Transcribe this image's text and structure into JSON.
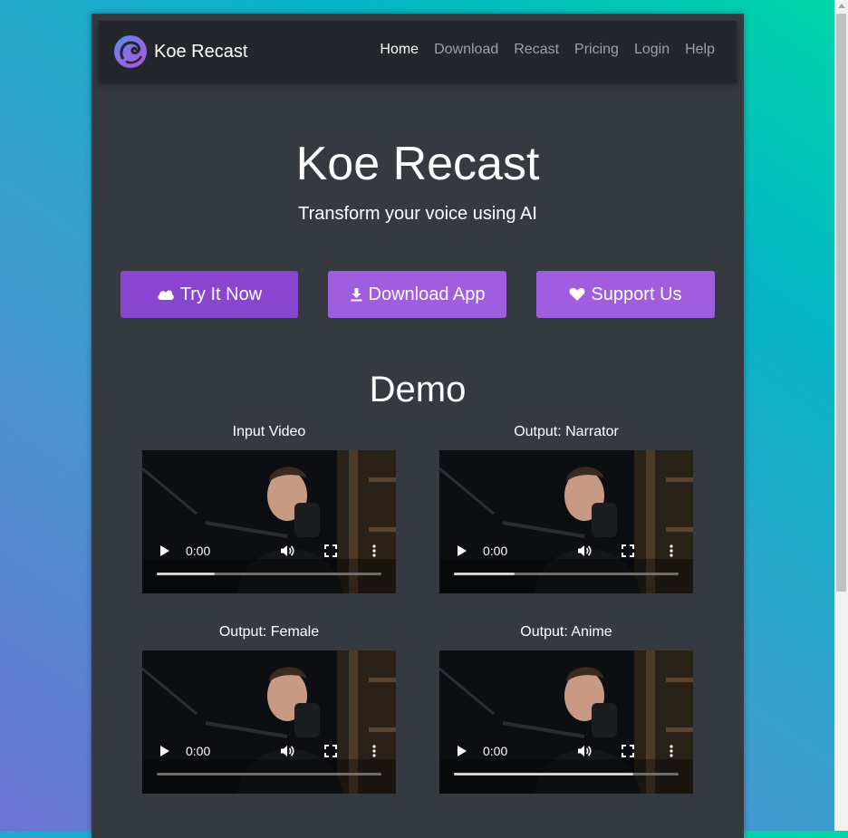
{
  "nav": {
    "brand": "Koe Recast",
    "links": [
      "Home",
      "Download",
      "Recast",
      "Pricing",
      "Login",
      "Help"
    ],
    "active": "Home"
  },
  "hero": {
    "title": "Koe Recast",
    "subtitle": "Transform your voice using AI"
  },
  "buttons": {
    "try": "Try It Now",
    "download": "Download App",
    "support": "Support Us"
  },
  "demo": {
    "title": "Demo",
    "videos": [
      {
        "label": "Input Video",
        "time": "0:00",
        "progress": 0.26
      },
      {
        "label": "Output: Narrator",
        "time": "0:00",
        "progress": 0.27
      },
      {
        "label": "Output: Female",
        "time": "0:00",
        "progress": 0.0
      },
      {
        "label": "Output: Anime",
        "time": "0:00",
        "progress": 0.8
      }
    ]
  },
  "icons": {
    "logo": "dragon-logo-icon",
    "try": "cloud-icon",
    "download": "download-icon",
    "support": "heart-icon",
    "play": "play-icon",
    "volume": "volume-icon",
    "fullscreen": "fullscreen-icon",
    "more": "more-vertical-icon"
  },
  "colors": {
    "primary_button": "#8a45d0",
    "secondary_button": "#a15de0",
    "page_bg": "#353a40",
    "navbar_bg": "#23272b"
  }
}
